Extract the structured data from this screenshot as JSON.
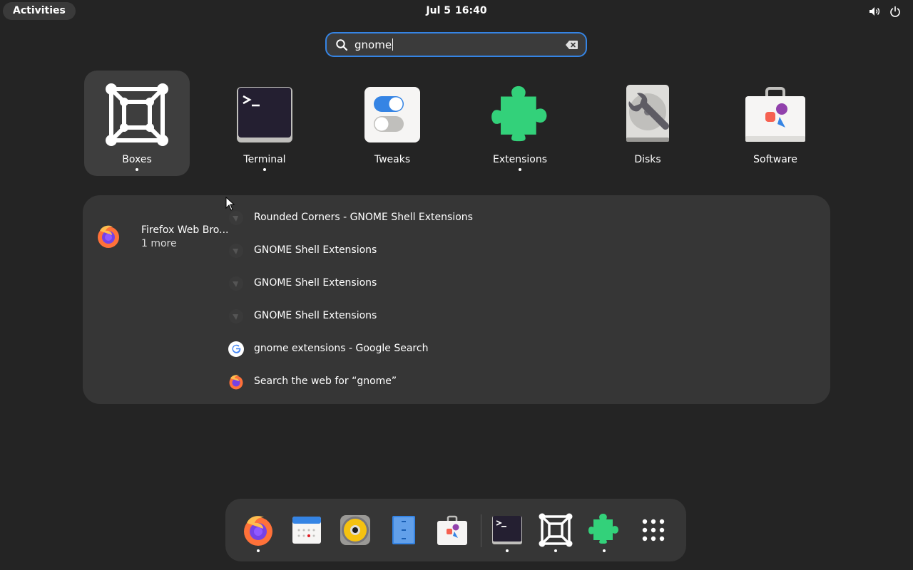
{
  "topbar": {
    "activities": "Activities",
    "date": "Jul 5",
    "time": "16:40",
    "volume_icon": "volume-icon",
    "power_icon": "power-icon"
  },
  "search": {
    "value": "gnome",
    "icon": "search-icon",
    "clear_icon": "clear-icon"
  },
  "apps": [
    {
      "label": "Boxes",
      "icon": "boxes-icon",
      "running": true,
      "selected": true
    },
    {
      "label": "Terminal",
      "icon": "terminal-icon",
      "running": true,
      "selected": false
    },
    {
      "label": "Tweaks",
      "icon": "tweaks-icon",
      "running": false,
      "selected": false
    },
    {
      "label": "Extensions",
      "icon": "extensions-icon",
      "running": true,
      "selected": false
    },
    {
      "label": "Disks",
      "icon": "disks-icon",
      "running": false,
      "selected": false
    },
    {
      "label": "Software",
      "icon": "software-icon",
      "running": false,
      "selected": false
    }
  ],
  "provider": {
    "name": "Firefox Web Bro...",
    "more": "1 more",
    "icon": "firefox-icon"
  },
  "results": [
    {
      "label": "Rounded Corners - GNOME Shell Extensions",
      "icon": "gnome-extensions-site-icon"
    },
    {
      "label": "GNOME Shell Extensions",
      "icon": "gnome-extensions-site-icon"
    },
    {
      "label": "GNOME Shell Extensions",
      "icon": "gnome-extensions-site-icon"
    },
    {
      "label": "GNOME Shell Extensions",
      "icon": "gnome-extensions-site-icon"
    },
    {
      "label": "gnome extensions - Google Search",
      "icon": "google-icon"
    },
    {
      "label": "Search the web for “gnome”",
      "icon": "firefox-icon"
    }
  ],
  "dock": [
    {
      "icon": "firefox-icon",
      "running": true
    },
    {
      "icon": "calendar-icon",
      "running": false
    },
    {
      "icon": "rhythmbox-icon",
      "running": false
    },
    {
      "icon": "files-icon",
      "running": false
    },
    {
      "icon": "software-icon",
      "running": false
    },
    {
      "icon": "terminal-icon",
      "running": true
    },
    {
      "icon": "boxes-icon",
      "running": true
    },
    {
      "icon": "extensions-icon",
      "running": true
    },
    {
      "icon": "app-grid-icon",
      "running": false
    }
  ],
  "colors": {
    "background": "#242424",
    "panel": "#363636",
    "accent": "#3584e4",
    "extensions_green": "#33d17a"
  }
}
